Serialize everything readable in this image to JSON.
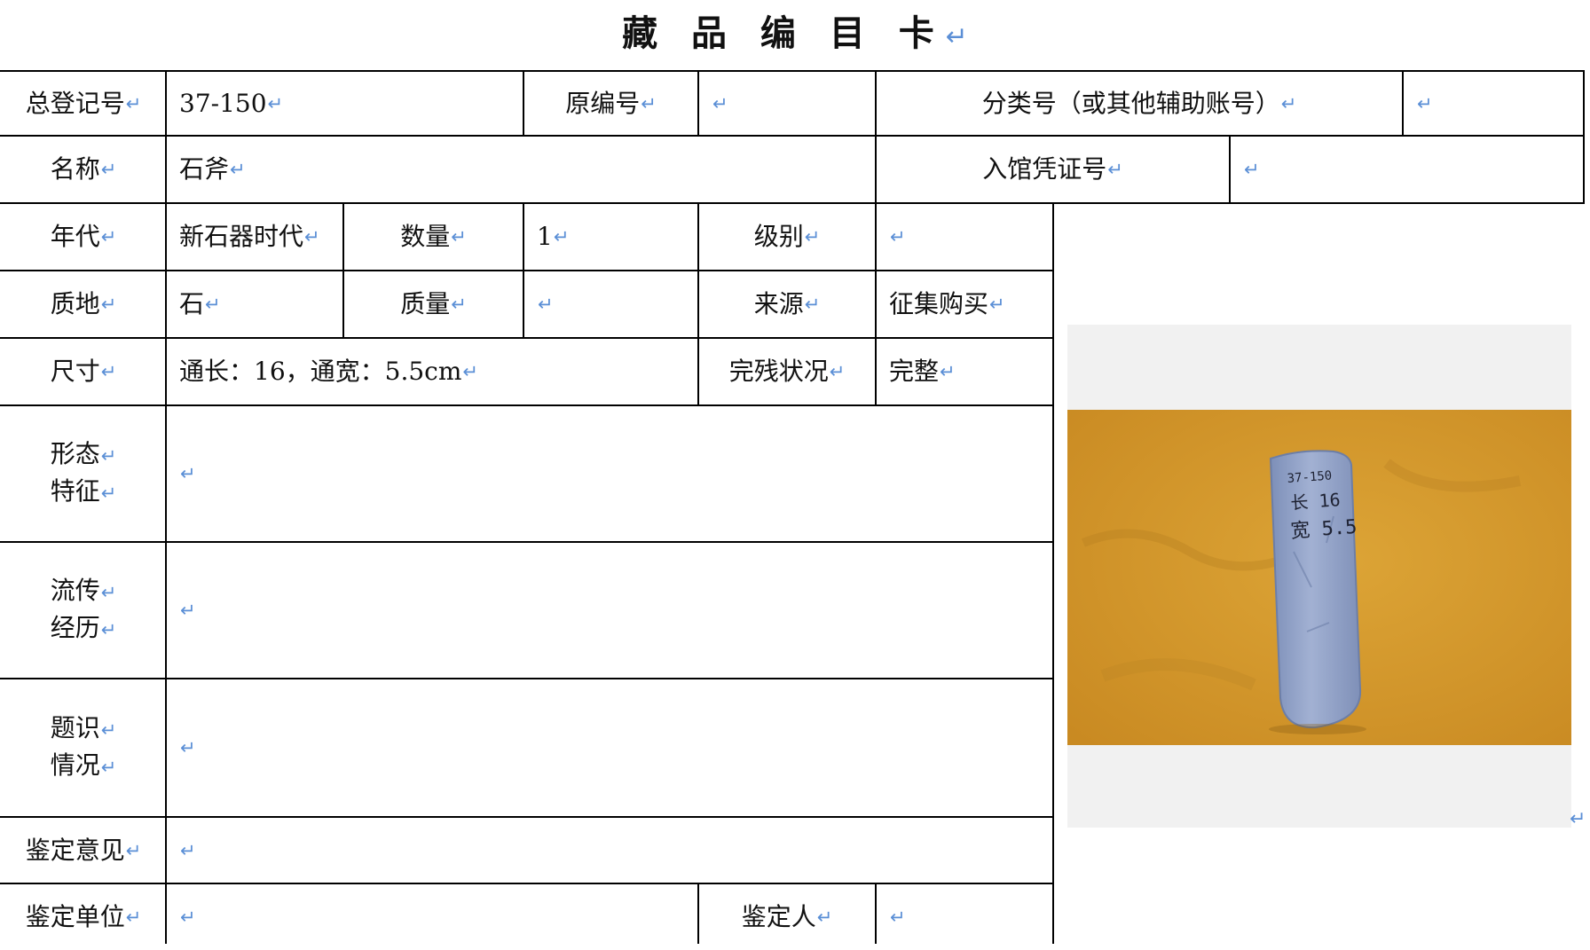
{
  "title": "藏 品 编 目 卡",
  "fields": {
    "registration_no": {
      "label": "总登记号",
      "value": "37-150"
    },
    "original_no": {
      "label": "原编号",
      "value": ""
    },
    "classification_no": {
      "label": "分类号（或其他辅助账号）",
      "value": ""
    },
    "name": {
      "label": "名称",
      "value": "石斧"
    },
    "accession_voucher_no": {
      "label": "入馆凭证号",
      "value": ""
    },
    "period": {
      "label": "年代",
      "value": "新石器时代"
    },
    "quantity": {
      "label": "数量",
      "value": "1"
    },
    "grade": {
      "label": "级别",
      "value": ""
    },
    "material": {
      "label": "质地",
      "value": "石"
    },
    "mass": {
      "label": "质量",
      "value": ""
    },
    "source": {
      "label": "来源",
      "value": "征集购买"
    },
    "dimensions": {
      "label": "尺寸",
      "value": "通长：16，通宽：5.5cm"
    },
    "condition": {
      "label": "完残状况",
      "value": "完整"
    },
    "form_features": {
      "label_lines": [
        "形态",
        "特征"
      ],
      "value": ""
    },
    "provenance": {
      "label_lines": [
        "流传",
        "经历"
      ],
      "value": ""
    },
    "inscriptions": {
      "label_lines": [
        "题识",
        "情况"
      ],
      "value": ""
    },
    "appraisal_opinion": {
      "label": "鉴定意见",
      "value": ""
    },
    "appraisal_unit": {
      "label": "鉴定单位",
      "value": ""
    },
    "appraiser": {
      "label": "鉴定人",
      "value": ""
    }
  },
  "photo": {
    "subject": "stone axe on yellow backdrop",
    "handwriting": [
      "37-150",
      "长 16",
      "宽 5.5"
    ],
    "colors": {
      "backdrop": "#d59a2c",
      "stone": "#8d9ec4",
      "frame": "#f1f1f1"
    }
  },
  "colors": {
    "grid": "#000000",
    "paragraph_mark": "#5b8fd6",
    "text": "#111111"
  }
}
